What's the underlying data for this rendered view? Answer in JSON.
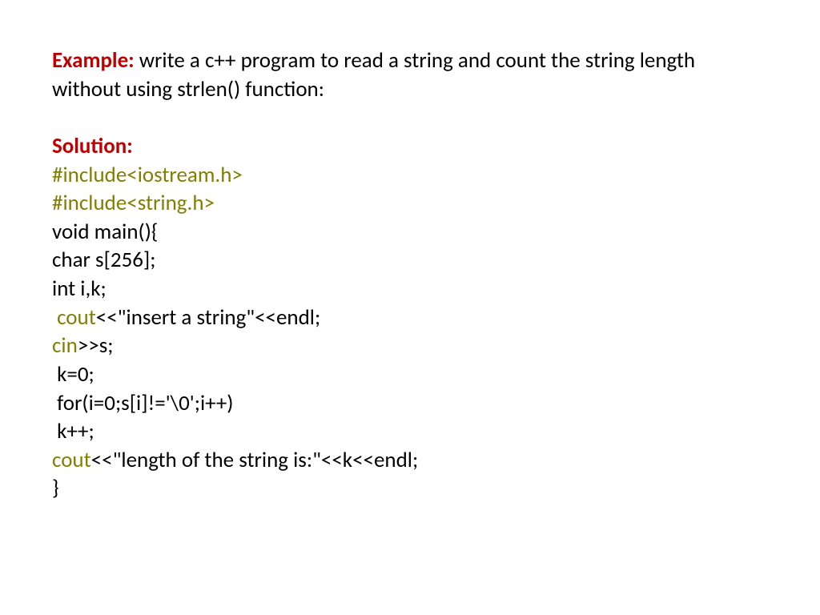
{
  "heading": {
    "example_label": "Example:",
    "example_text": " write a c++ program to read a string and count the string length without using strlen() function:"
  },
  "solution": {
    "label": "Solution:",
    "lines": [
      {
        "parts": [
          {
            "text": "#include<iostream.h>",
            "style": "olive"
          }
        ]
      },
      {
        "parts": [
          {
            "text": "#include<string.h>",
            "style": "olive"
          }
        ]
      },
      {
        "parts": [
          {
            "text": "void main(){",
            "style": "black"
          }
        ]
      },
      {
        "parts": [
          {
            "text": "char s[256];",
            "style": "black"
          }
        ]
      },
      {
        "parts": [
          {
            "text": "int i,k;",
            "style": "black"
          }
        ]
      },
      {
        "parts": [
          {
            "text": " ",
            "style": "black"
          },
          {
            "text": "cout",
            "style": "olive"
          },
          {
            "text": "<<\"insert a string\"<<endl;",
            "style": "black"
          }
        ]
      },
      {
        "parts": [
          {
            "text": "cin",
            "style": "olive"
          },
          {
            "text": ">>s;",
            "style": "black"
          }
        ]
      },
      {
        "parts": [
          {
            "text": " k=0;",
            "style": "black"
          }
        ]
      },
      {
        "parts": [
          {
            "text": " for(i=0;s[i]!='\\0';i++)",
            "style": "black"
          }
        ]
      },
      {
        "parts": [
          {
            "text": " k++;",
            "style": "black"
          }
        ]
      },
      {
        "parts": [
          {
            "text": "cout",
            "style": "olive"
          },
          {
            "text": "<<\"length of the string is:\"<<k<<endl;",
            "style": "black"
          }
        ]
      },
      {
        "parts": [
          {
            "text": "}",
            "style": "black"
          }
        ]
      }
    ]
  }
}
